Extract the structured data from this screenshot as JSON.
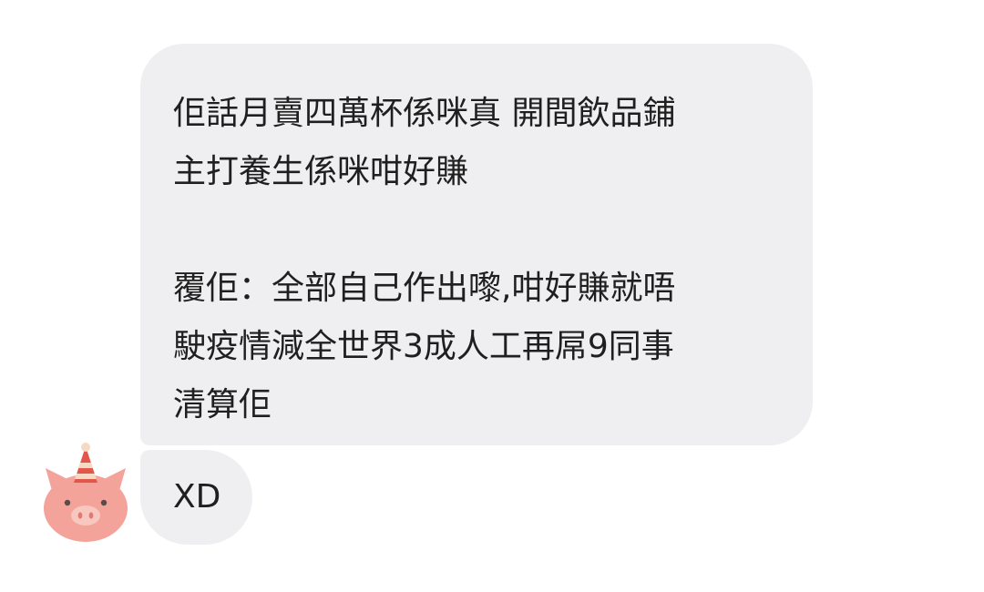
{
  "messages": [
    {
      "sender": "other",
      "lines": [
        "佢話月賣四萬杯係咪真 開間飲品鋪",
        "主打養生係咪咁好賺",
        "",
        "覆佢：全部自己作出嚟,咁好賺就唔",
        "駛疫情減全世界3成人工再屌9同事",
        "清算佢"
      ]
    },
    {
      "sender": "other",
      "lines": [
        "XD"
      ]
    }
  ],
  "avatar": {
    "icon": "pig-with-party-hat-icon",
    "colors": {
      "face": "#f3a39a",
      "snout": "#f8c7bf",
      "hat_red": "#e2574c",
      "hat_stripe": "#f6d9c2"
    }
  },
  "colors": {
    "bubble_bg": "#efeff1",
    "text": "#1f1f1f",
    "page_bg": "#ffffff"
  }
}
